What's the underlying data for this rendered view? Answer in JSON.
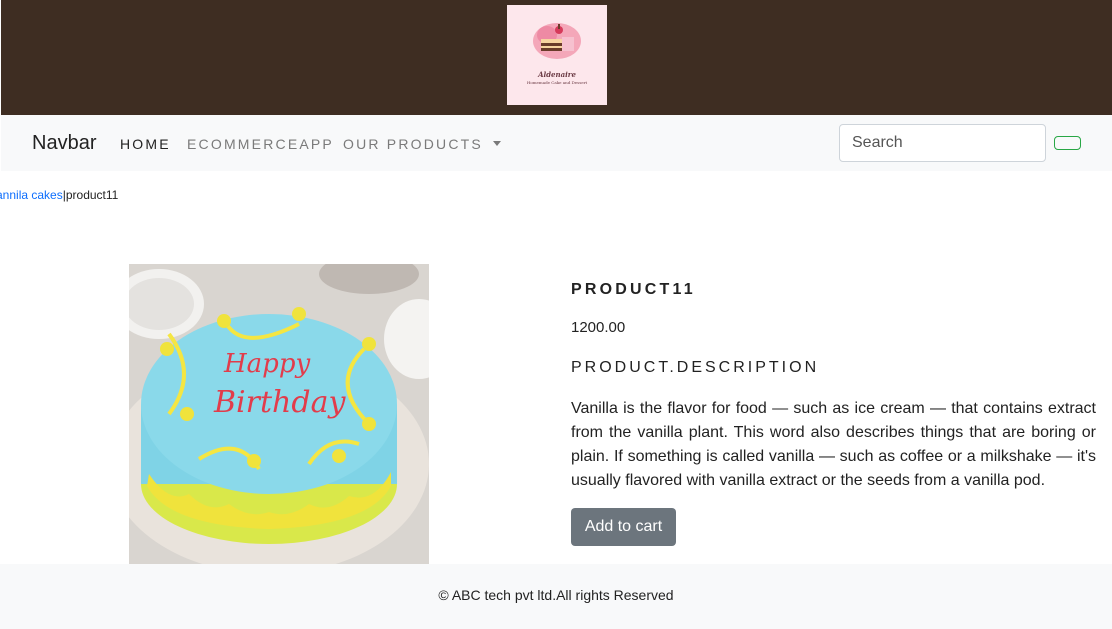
{
  "header": {
    "logo": {
      "script_text": "Aldenaire",
      "subtitle": "Homemade Cake and Dessert"
    }
  },
  "navbar": {
    "brand": "Navbar",
    "links": [
      {
        "label": "HOME"
      },
      {
        "label": "ECOMMERCEAPP"
      },
      {
        "label": "OUR PRODUCTS"
      }
    ],
    "search": {
      "placeholder": "Search",
      "value": ""
    },
    "search_button_label": ""
  },
  "breadcrumb": {
    "link": "annila cakes",
    "separator": "|",
    "current": "product11"
  },
  "product": {
    "name": "PRODUCT11",
    "price": "1200.00",
    "description_heading": "PRODUCT.DESCRIPTION",
    "description": "Vanilla is the flavor for food — such as ice cream — that contains extract from the vanilla plant. This word also describes things that are boring or plain. If something is called vanilla — such as coffee or a milkshake — it's usually flavored with vanilla extract or the seeds from a vanilla pod.",
    "image_icon": "birthday-cake-photo",
    "cake_text_line1": "Happy",
    "cake_text_line2": "Birthday",
    "add_to_cart_label": "Add to cart"
  },
  "footer": {
    "text": "© ABC tech pvt ltd.All rights Reserved"
  },
  "colors": {
    "topbar": "#3e2d22",
    "navbar": "#f8f9fa",
    "link": "#0d6efd",
    "button": "#6c757d",
    "search_outline": "#28a745",
    "cake_frosting": "#7fd3e6",
    "cake_icing": "#f3e23a"
  }
}
